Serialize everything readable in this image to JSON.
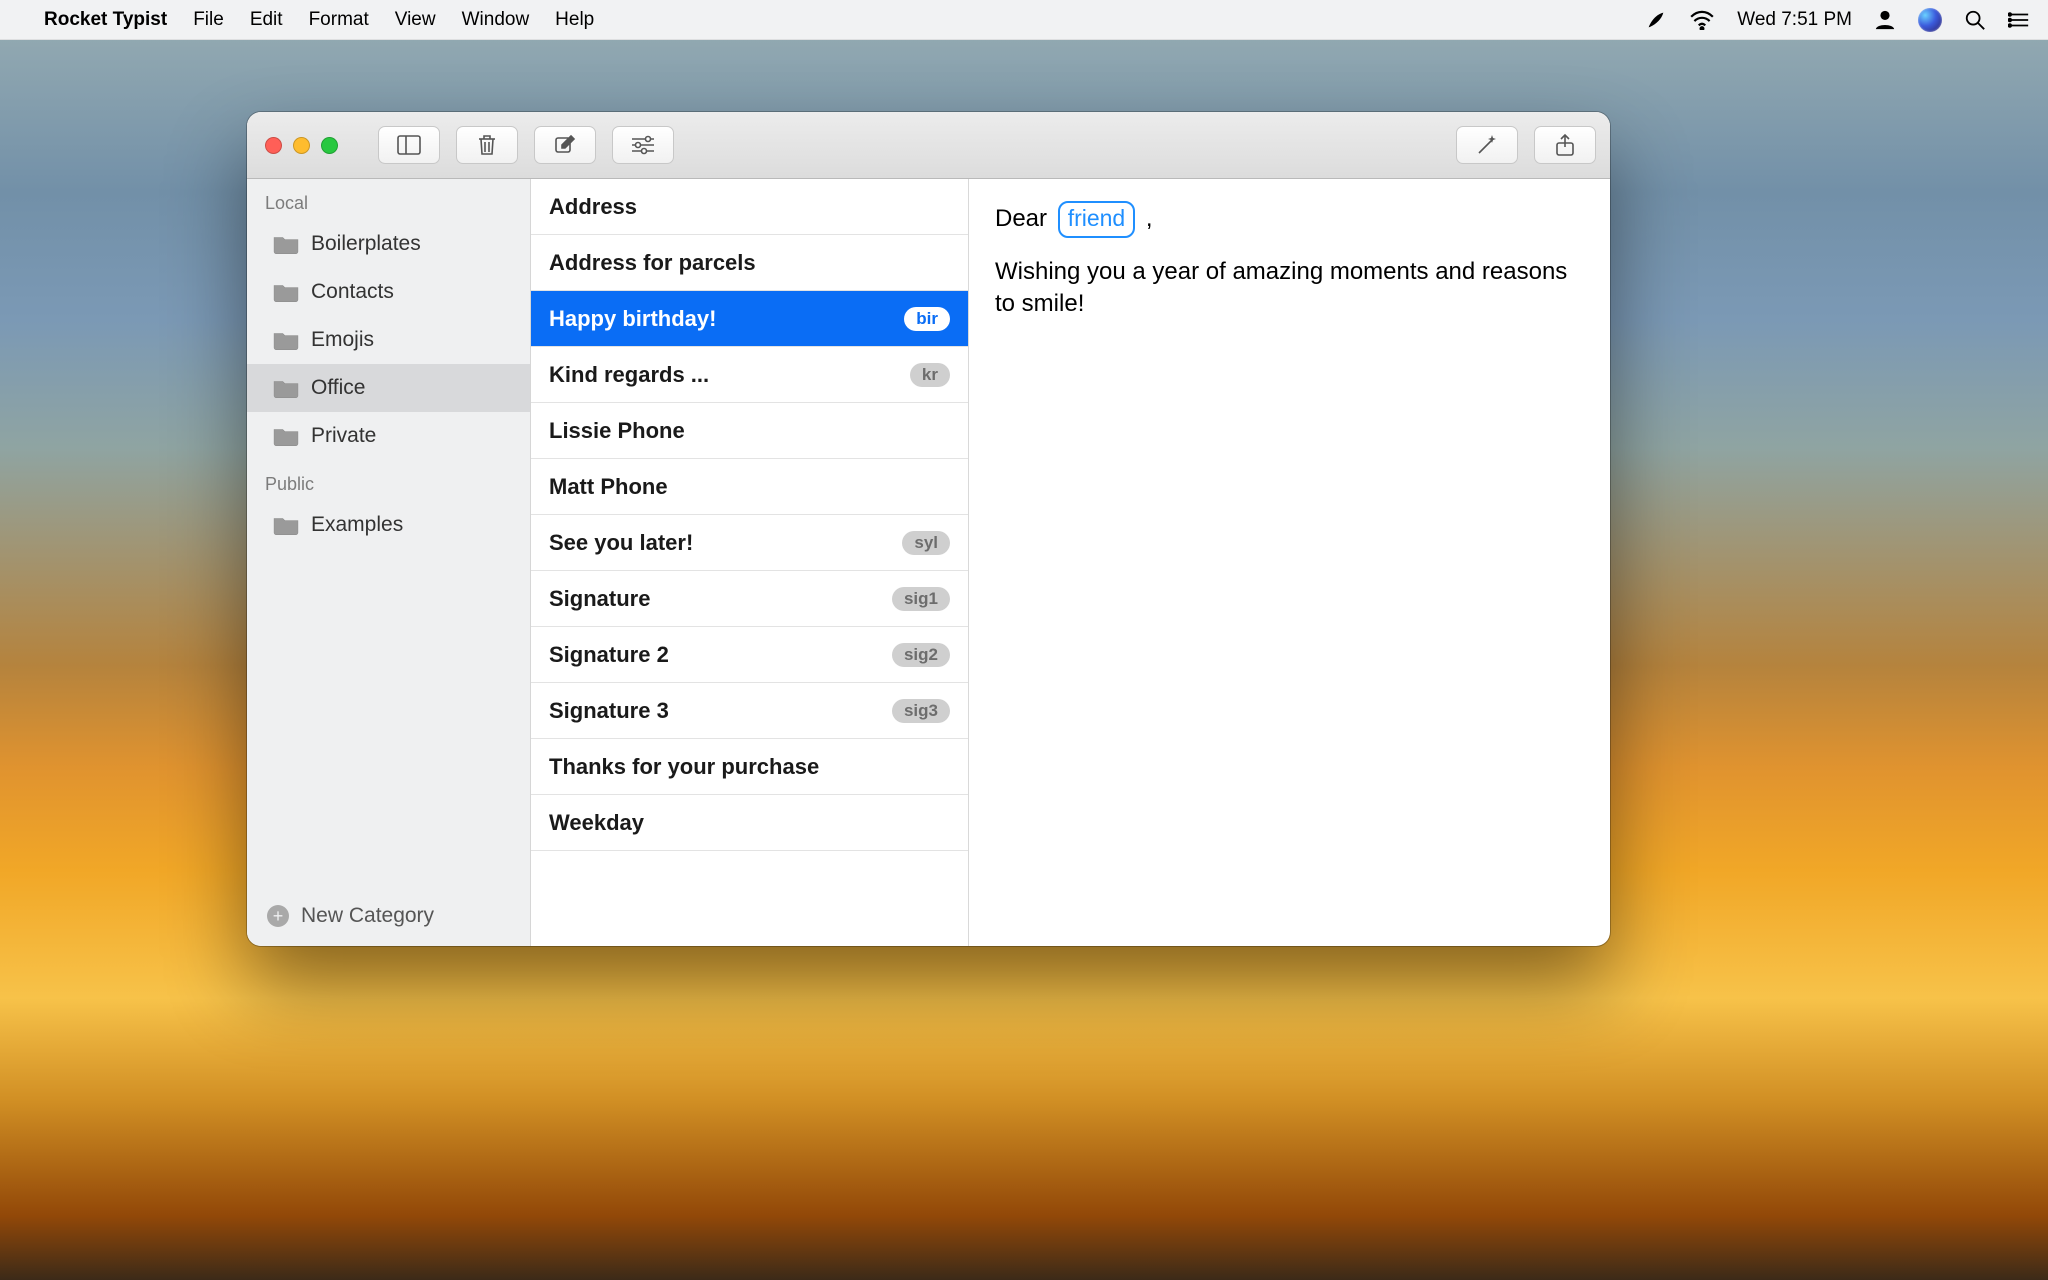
{
  "menubar": {
    "app_name": "Rocket Typist",
    "items": [
      "File",
      "Edit",
      "Format",
      "View",
      "Window",
      "Help"
    ],
    "clock": "Wed 7:51 PM"
  },
  "toolbar": {
    "buttons": [
      "sidebar-toggle",
      "trash",
      "compose",
      "settings",
      "wand",
      "share"
    ]
  },
  "sidebar": {
    "sections": [
      {
        "label": "Local",
        "items": [
          {
            "label": "Boilerplates",
            "selected": false
          },
          {
            "label": "Contacts",
            "selected": false
          },
          {
            "label": "Emojis",
            "selected": false
          },
          {
            "label": "Office",
            "selected": true
          },
          {
            "label": "Private",
            "selected": false
          }
        ]
      },
      {
        "label": "Public",
        "items": [
          {
            "label": "Examples",
            "selected": false
          }
        ]
      }
    ],
    "new_category_label": "New Category"
  },
  "snippets": [
    {
      "title": "Address",
      "abbr": "",
      "selected": false
    },
    {
      "title": "Address for parcels",
      "abbr": "",
      "selected": false
    },
    {
      "title": "Happy birthday!",
      "abbr": "bir",
      "selected": true
    },
    {
      "title": "Kind regards ...",
      "abbr": "kr",
      "selected": false
    },
    {
      "title": "Lissie Phone",
      "abbr": "",
      "selected": false
    },
    {
      "title": "Matt Phone",
      "abbr": "",
      "selected": false
    },
    {
      "title": "See you later!",
      "abbr": "syl",
      "selected": false
    },
    {
      "title": "Signature",
      "abbr": "sig1",
      "selected": false
    },
    {
      "title": "Signature 2",
      "abbr": "sig2",
      "selected": false
    },
    {
      "title": "Signature 3",
      "abbr": "sig3",
      "selected": false
    },
    {
      "title": "Thanks for your purchase",
      "abbr": "",
      "selected": false
    },
    {
      "title": "Weekday",
      "abbr": "",
      "selected": false
    }
  ],
  "editor": {
    "greeting_prefix": "Dear ",
    "placeholder": "friend",
    "greeting_suffix": " ,",
    "body": "Wishing you a year of amazing moments and reasons to smile!"
  }
}
